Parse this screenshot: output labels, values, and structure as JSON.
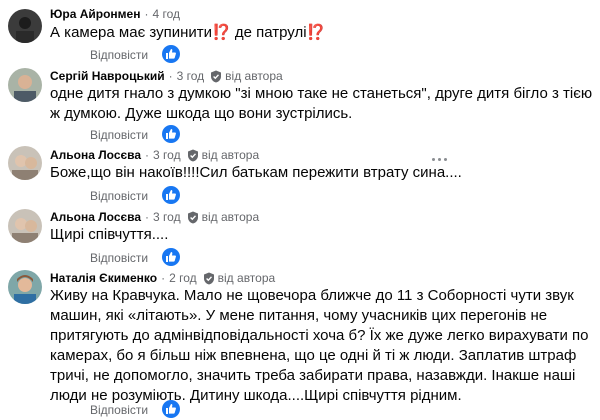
{
  "colors": {
    "link": "#65676b",
    "like": "#1877f2",
    "text": "#050505"
  },
  "comments": [
    {
      "author": "Юра Айронмен",
      "time": "4 год",
      "author_badge": "",
      "text_before": "А камера має зупинити",
      "emoji_1": "⁉️",
      "text_middle": " де патрулі",
      "emoji_2": "⁉️",
      "reply_label": "Відповісти"
    },
    {
      "author": "Сергій Навроцький",
      "time": "3 год",
      "author_badge": "від автора",
      "text": "одне дитя гнало з думкою \"зі мною таке не станеться\", друге дитя бігло з тією ж думкою. Дуже шкода що вони зустрілись.",
      "reply_label": "Відповісти"
    },
    {
      "author": "Альона Лосєва",
      "time": "3 год",
      "author_badge": "від автора",
      "text": "Боже,що він накоїв!!!!Сил батькам пережити втрату сина....",
      "reply_label": "Відповісти"
    },
    {
      "author": "Альона Лосєва",
      "time": "3 год",
      "author_badge": "від автора",
      "text": "Щирі співчуття....",
      "reply_label": "Відповісти"
    },
    {
      "author": "Наталія Єкименко",
      "time": "2 год",
      "author_badge": "від автора",
      "text": "Живу на Кравчука. Мало не щовечора ближче до 11 з Соборності чути звук машин, які «літають». У мене питання, чому учасників цих перегонів не притягують до адмінвідповідальності хоча б? Їх же дуже легко вирахувати по камерах, бо я більш ніж впевнена, що це одні й ті ж люди. Заплатив штраф тричі, не допомогло, значить треба забирати права, назавжди. Інакше наші люди не розуміють. Дитину шкода....Щирі співчуття рідним.",
      "reply_label": "Відповісти"
    }
  ]
}
